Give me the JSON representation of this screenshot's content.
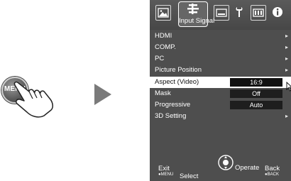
{
  "remote": {
    "button_label": "MENU"
  },
  "tabs": [
    {
      "icon": "picture-icon"
    },
    {
      "icon": "input-signal-icon",
      "label": "Input Signal"
    },
    {
      "icon": "installation-icon"
    },
    {
      "icon": "function-icon"
    },
    {
      "icon": "memory-icon"
    },
    {
      "icon": "information-icon"
    }
  ],
  "menu": {
    "items": [
      {
        "label": "HDMI",
        "submenu": true
      },
      {
        "label": "COMP.",
        "submenu": true
      },
      {
        "label": "PC",
        "submenu": true
      },
      {
        "label": "Picture Position",
        "submenu": true
      },
      {
        "label": "Aspect (Video)",
        "value": "16:9",
        "selected": true
      },
      {
        "label": "Mask",
        "value": "Off"
      },
      {
        "label": "Progressive",
        "value": "Auto"
      },
      {
        "label": "3D Setting",
        "submenu": true
      }
    ],
    "chevron": "▸"
  },
  "footer": {
    "exit_label": "Exit",
    "exit_sub": "●MENU",
    "select_label": "Select",
    "operate_label": "Operate",
    "back_label": "Back",
    "back_sub": "●BACK"
  },
  "colors": {
    "menu_bg": "#4e4e4e",
    "highlight": "#ffffff",
    "value_box": "#1e1e1e",
    "arrow": "#7a7a7a"
  }
}
